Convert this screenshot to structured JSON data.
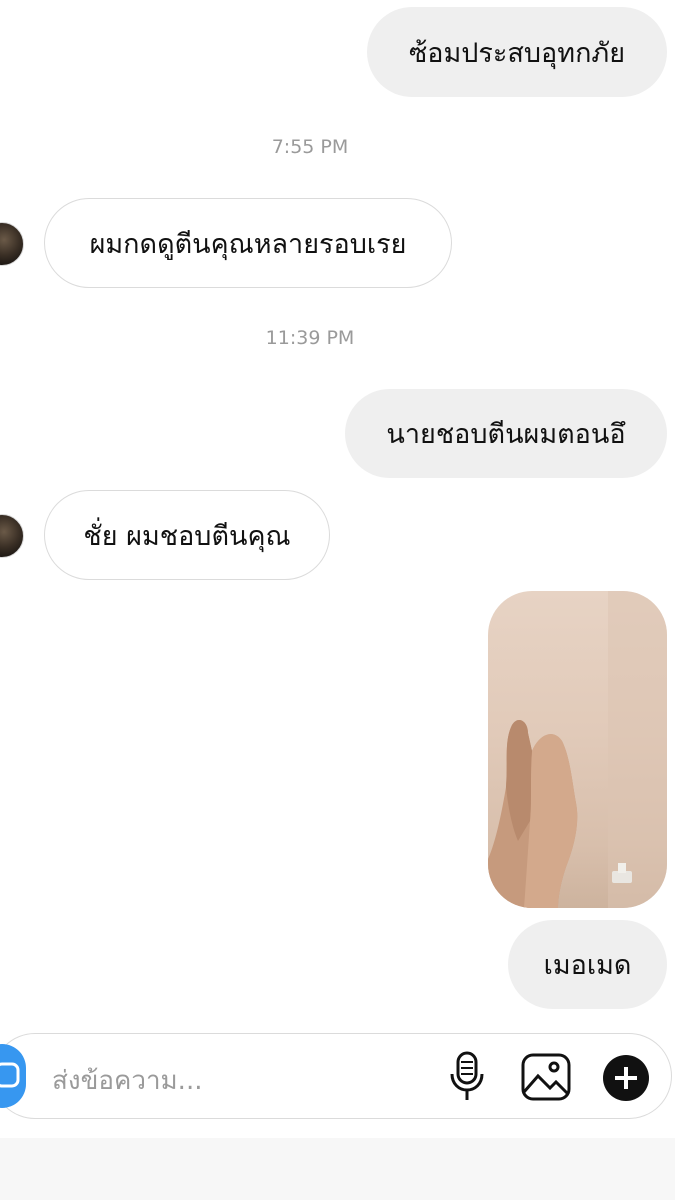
{
  "messages": [
    {
      "sender": "me",
      "text": "ซ้อมประสบอุทกภัย"
    },
    {
      "timestamp": "7:55 PM"
    },
    {
      "sender": "them",
      "text": "ผมกดดูตีนคุณหลายรอบเรย"
    },
    {
      "timestamp": "11:39 PM"
    },
    {
      "sender": "me",
      "text": "นายชอบตีนผมตอนอึ"
    },
    {
      "sender": "them",
      "text": "ชั่ย ผมชอบตีนคุณ"
    },
    {
      "sender": "me",
      "type": "image",
      "icon": "photo-feet"
    },
    {
      "sender": "me",
      "text": "เมอเมด"
    }
  ],
  "composer": {
    "placeholder": "ส่งข้อความ...",
    "icons": [
      "camera-icon",
      "microphone-icon",
      "gallery-icon",
      "add-icon"
    ],
    "accent_color": "#3797f0"
  }
}
